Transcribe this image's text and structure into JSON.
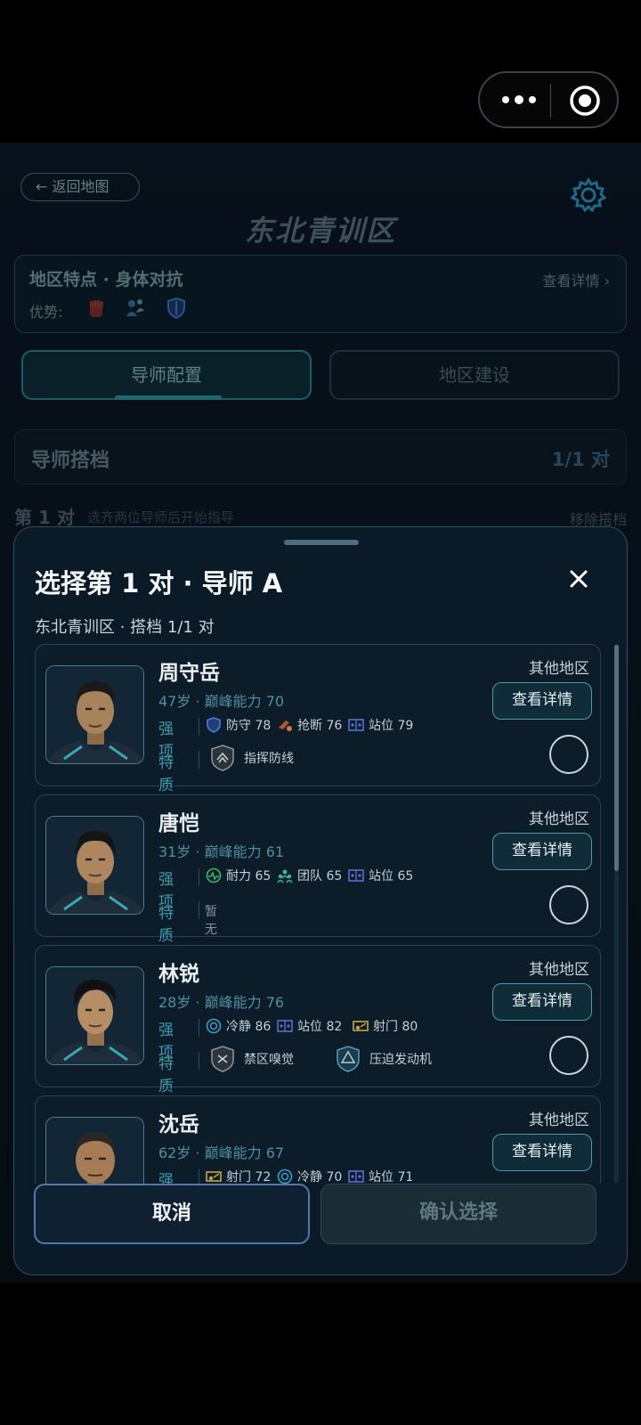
{
  "topbar": {
    "more_icon": "more-dots-icon",
    "record_icon": "record-target-icon"
  },
  "page": {
    "back_label": "← 返回地图",
    "title": "东北青训区",
    "settings_icon": "gear-icon",
    "feature": {
      "title": "地区特点 · 身体对抗",
      "link": "查看详情 ›",
      "advantage_label": "优势:",
      "advantage_icons": [
        "fist-icon",
        "players-icon",
        "shield-icon"
      ]
    },
    "tabs": [
      {
        "label": "导师配置",
        "active": true
      },
      {
        "label": "地区建设",
        "active": false
      }
    ],
    "section": {
      "title": "导师搭档",
      "count": "1/1 对"
    },
    "pair": {
      "label": "第 1 对",
      "hint": "选齐两位导师后开始指导",
      "remove": "移除搭档"
    }
  },
  "sheet": {
    "title": "选择第 1 对 · 导师 A",
    "subtitle": "东北青训区 · 搭档 1/1 对",
    "close_icon": "close-icon",
    "strength_label": "强项",
    "trait_label": "特质",
    "mentors": [
      {
        "name": "周守岳",
        "meta": "47岁 · 巅峰能力 70",
        "region": "其他地区",
        "detail_label": "查看详情",
        "selected": false,
        "stats": [
          {
            "icon": "shield-icon",
            "label": "防守 78"
          },
          {
            "icon": "tackle-icon",
            "label": "抢断 76"
          },
          {
            "icon": "position-icon",
            "label": "站位 79"
          }
        ],
        "traits": [
          {
            "icon": "command-badge-icon",
            "label": "指挥防线"
          }
        ],
        "trait_none": ""
      },
      {
        "name": "唐恺",
        "meta": "31岁 · 巅峰能力 61",
        "region": "其他地区",
        "detail_label": "查看详情",
        "selected": false,
        "stats": [
          {
            "icon": "stamina-icon",
            "label": "耐力 65"
          },
          {
            "icon": "team-icon",
            "label": "团队 65"
          },
          {
            "icon": "position-icon",
            "label": "站位 65"
          }
        ],
        "traits": [],
        "trait_none": "暂无"
      },
      {
        "name": "林锐",
        "meta": "28岁 · 巅峰能力 76",
        "region": "其他地区",
        "detail_label": "查看详情",
        "selected": false,
        "stats": [
          {
            "icon": "calm-icon",
            "label": "冷静 86"
          },
          {
            "icon": "position-icon",
            "label": "站位 82"
          },
          {
            "icon": "shooting-icon",
            "label": "射门 80"
          }
        ],
        "traits": [
          {
            "icon": "box-sense-badge-icon",
            "label": "禁区嗅觉"
          },
          {
            "icon": "press-engine-badge-icon",
            "label": "压迫发动机"
          }
        ],
        "trait_none": ""
      },
      {
        "name": "沈岳",
        "meta": "62岁 · 巅峰能力 67",
        "region": "其他地区",
        "detail_label": "查看详情",
        "selected": false,
        "stats": [
          {
            "icon": "shooting-icon",
            "label": "射门 72"
          },
          {
            "icon": "calm-icon",
            "label": "冷静 70"
          },
          {
            "icon": "position-icon",
            "label": "站位 71"
          }
        ],
        "traits": [],
        "trait_none": ""
      }
    ],
    "cancel_label": "取消",
    "confirm_label": "确认选择"
  },
  "colors": {
    "accent": "#2b9fae",
    "background": "#0a1a26",
    "text": "#e8eef4"
  }
}
